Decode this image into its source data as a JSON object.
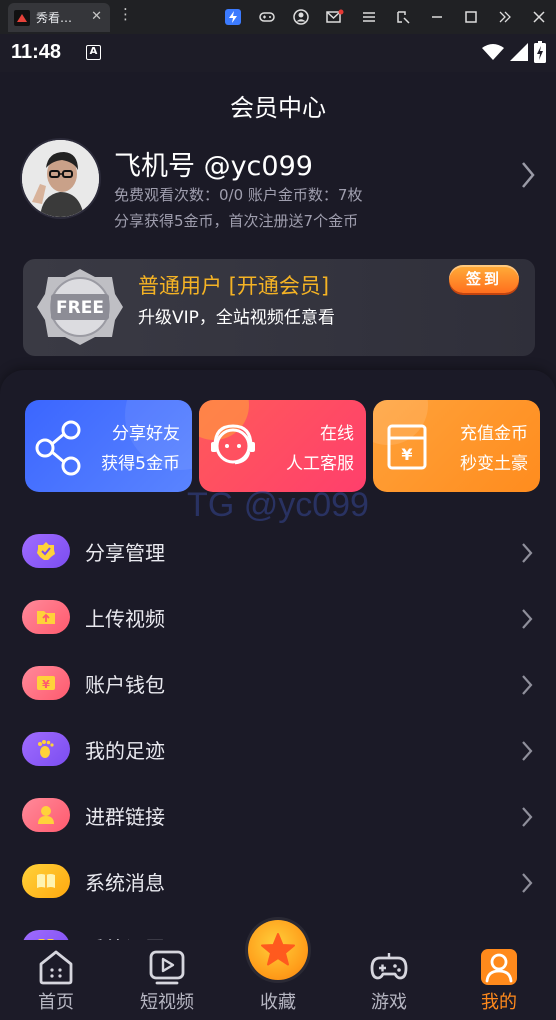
{
  "browser": {
    "tab_title": "秀看…",
    "tab_close": "✕",
    "menu_dots": "⋮"
  },
  "status": {
    "time": "11:48",
    "a_badge": "A"
  },
  "header": {
    "title": "会员中心"
  },
  "profile": {
    "nickname": "飞机号 @yc099",
    "stats": "免费观看次数：0/0 账户金币数：7枚",
    "share_note": "分享获得5金币，首次注册送7个金币"
  },
  "vip": {
    "badge_text": "FREE",
    "title": "普通用户 [开通会员]",
    "subtitle": "升级VIP，全站视频任意看",
    "signin_label": "签到"
  },
  "features": [
    {
      "line1": "分享好友",
      "line2": "获得5金币",
      "icon": "share-icon"
    },
    {
      "line1": "在线",
      "line2": "人工客服",
      "icon": "customer-service-icon"
    },
    {
      "line1": "充值金币",
      "line2": "秒变土豪",
      "icon": "yuan-wallet-icon"
    }
  ],
  "watermark": "TG @yc099",
  "menu": [
    {
      "label": "分享管理",
      "icon": "share-manage-icon",
      "color": "#8b5cf6"
    },
    {
      "label": "上传视频",
      "icon": "upload-folder-icon",
      "color": "#ff6a7a"
    },
    {
      "label": "账户钱包",
      "icon": "wallet-icon",
      "color": "#ff6a7a"
    },
    {
      "label": "我的足迹",
      "icon": "footprint-icon",
      "color": "#8b5cf6"
    },
    {
      "label": "进群链接",
      "icon": "group-link-icon",
      "color": "#ff6a7a"
    },
    {
      "label": "系统消息",
      "icon": "message-book-icon",
      "color": "#ffb81c"
    },
    {
      "label": "系统设置",
      "icon": "settings-icon",
      "color": "#8b5cf6"
    }
  ],
  "nav": [
    {
      "label": "首页",
      "icon": "home-icon"
    },
    {
      "label": "短视频",
      "icon": "play-icon"
    },
    {
      "label": "收藏",
      "icon": "star-icon"
    },
    {
      "label": "游戏",
      "icon": "gamepad-icon"
    },
    {
      "label": "我的",
      "icon": "user-icon",
      "active": true
    }
  ],
  "colors": {
    "accent": "#ff8a1c",
    "vip_gold": "#f5b324",
    "background": "#1b1a26"
  }
}
